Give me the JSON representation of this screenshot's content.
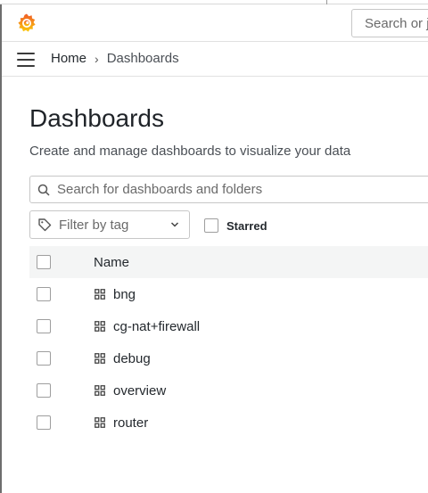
{
  "topbar": {
    "search_placeholder": "Search or jump to..."
  },
  "breadcrumb": {
    "home": "Home",
    "separator": "›",
    "current": "Dashboards"
  },
  "page": {
    "title": "Dashboards",
    "subtitle": "Create and manage dashboards to visualize your data"
  },
  "search": {
    "placeholder": "Search for dashboards and folders"
  },
  "filter": {
    "tag_label": "Filter by tag",
    "starred_label": "Starred"
  },
  "table": {
    "header_name": "Name",
    "rows": [
      {
        "label": "bng",
        "icon": "dashboard-grid-icon"
      },
      {
        "label": "cg-nat+firewall",
        "icon": "dashboard-grid-icon"
      },
      {
        "label": "debug",
        "icon": "dashboard-grid-icon"
      },
      {
        "label": "overview",
        "icon": "dashboard-grid-icon"
      },
      {
        "label": "router",
        "icon": "dashboard-grid-icon"
      }
    ]
  },
  "colors": {
    "logo_orange": "#f05a28",
    "logo_yellow": "#fbca0a",
    "header_bg": "#f4f5f5"
  }
}
